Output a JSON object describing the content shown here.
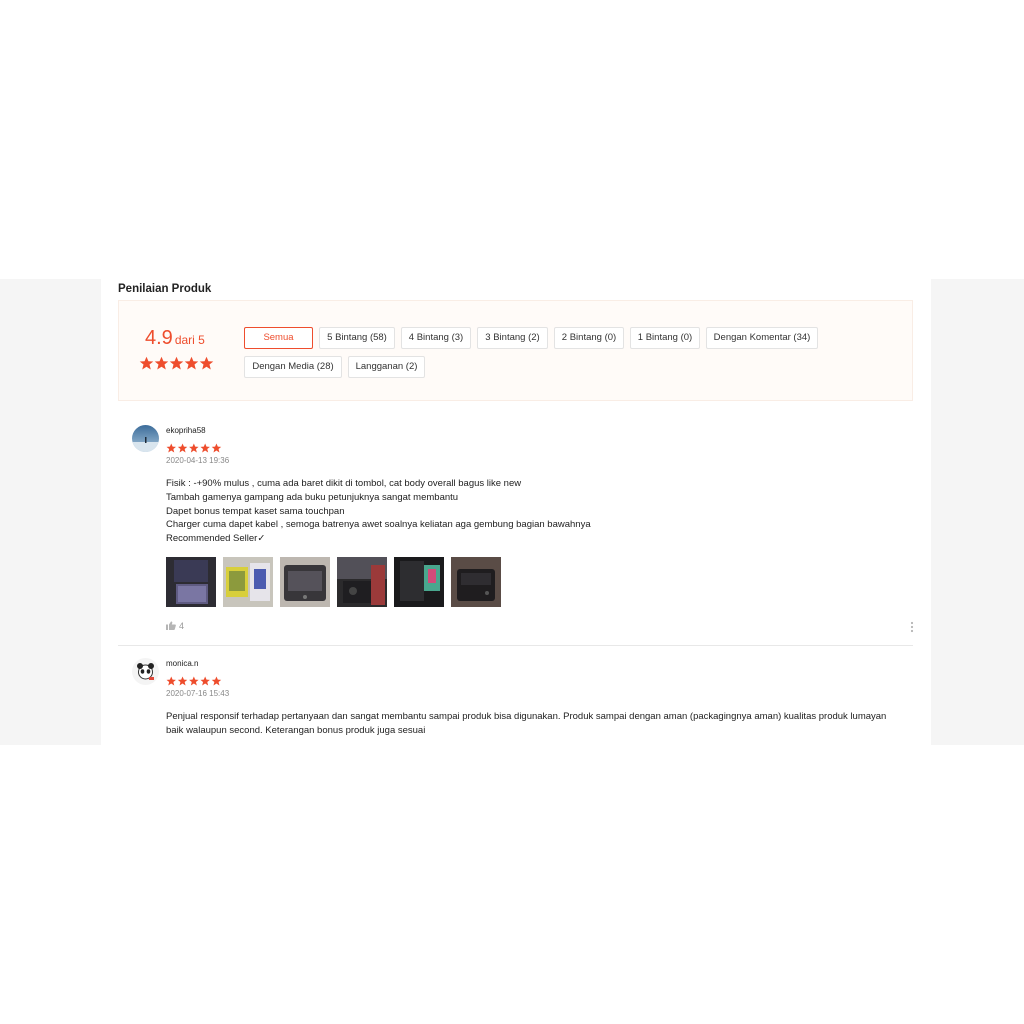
{
  "section_title": "Penilaian Produk",
  "rating": {
    "score": "4.9",
    "out_of": "dari 5",
    "stars": 5,
    "accent_color": "#ee4d2d"
  },
  "filters": [
    {
      "label": "Semua",
      "active": true
    },
    {
      "label": "5 Bintang (58)",
      "active": false
    },
    {
      "label": "4 Bintang (3)",
      "active": false
    },
    {
      "label": "3 Bintang (2)",
      "active": false
    },
    {
      "label": "2 Bintang (0)",
      "active": false
    },
    {
      "label": "1 Bintang (0)",
      "active": false
    },
    {
      "label": "Dengan Komentar (34)",
      "active": false
    },
    {
      "label": "Dengan Media (28)",
      "active": false
    },
    {
      "label": "Langganan (2)",
      "active": false
    }
  ],
  "reviews": [
    {
      "username": "ekopriha58",
      "stars": 5,
      "date": "2020-04-13 19:36",
      "lines": [
        "Fisik : -+90% mulus , cuma ada baret dikit di tombol, cat body overall bagus like new",
        "Tambah gamenya gampang ada buku petunjuknya sangat membantu",
        "Dapet bonus tempat kaset sama touchpan",
        "Charger cuma dapet kabel , semoga batrenya awet soalnya keliatan aga gembung bagian bawahnya",
        "Recommended Seller✓"
      ],
      "media_count": 6,
      "likes": "4"
    },
    {
      "username": "monica.n",
      "stars": 5,
      "date": "2020-07-16 15:43",
      "lines": [
        "Penjual responsif terhadap pertanyaan dan sangat membantu sampai produk bisa digunakan. Produk sampai dengan aman (packagingnya aman) kualitas produk lumayan baik walaupun second. Keterangan bonus produk juga sesuai"
      ]
    }
  ]
}
